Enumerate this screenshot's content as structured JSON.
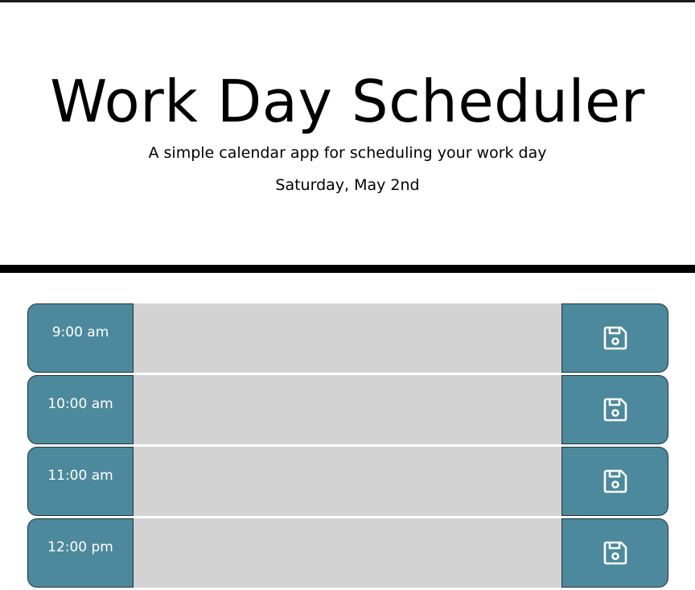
{
  "header": {
    "title": "Work Day Scheduler",
    "subtitle": "A simple calendar app for scheduling your work day",
    "current_day": "Saturday, May 2nd"
  },
  "colors": {
    "hour_block": "#4d899c",
    "past_textarea": "#d3d3d3",
    "border": "#1d3540"
  },
  "time_blocks": [
    {
      "hour": "9:00 am",
      "description": "",
      "save_icon": "floppy-disk-icon"
    },
    {
      "hour": "10:00 am",
      "description": "",
      "save_icon": "floppy-disk-icon"
    },
    {
      "hour": "11:00 am",
      "description": "",
      "save_icon": "floppy-disk-icon"
    },
    {
      "hour": "12:00 pm",
      "description": "",
      "save_icon": "floppy-disk-icon"
    }
  ]
}
